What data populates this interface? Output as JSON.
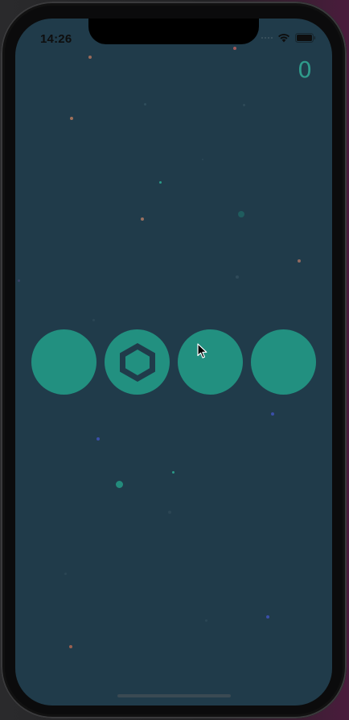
{
  "status_bar": {
    "time": "14:26",
    "wifi_icon": "wifi-icon",
    "battery_icon": "battery-icon"
  },
  "game": {
    "score": "0",
    "buttons": [
      {
        "name": "game-circle-1",
        "shape": "none"
      },
      {
        "name": "game-circle-2",
        "shape": "hexagon"
      },
      {
        "name": "game-circle-3",
        "shape": "none"
      },
      {
        "name": "game-circle-4",
        "shape": "none"
      }
    ]
  },
  "colors": {
    "background": "#203b4a",
    "circle": "#229080",
    "score": "#2f9b8b",
    "hexagon": "#203b4a"
  }
}
